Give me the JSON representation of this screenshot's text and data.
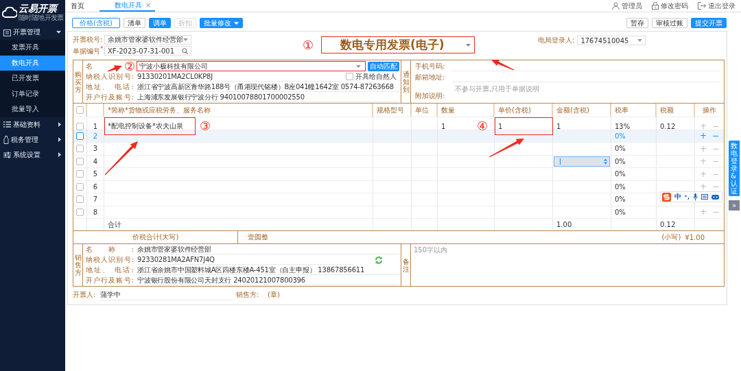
{
  "sidebar": {
    "logo_title": "云易开票",
    "logo_subtitle": "随时随地开发票",
    "groups": [
      {
        "label": "开票管理",
        "expanded": true,
        "items": [
          {
            "label": "发票开具",
            "selected": false
          },
          {
            "label": "数电开具",
            "selected": true
          },
          {
            "label": "已开发票",
            "selected": false
          },
          {
            "label": "订单记录",
            "selected": false
          },
          {
            "label": "批量导入",
            "selected": false
          }
        ]
      },
      {
        "label": "基础资料",
        "expanded": false
      },
      {
        "label": "税务管理",
        "expanded": false
      },
      {
        "label": "系统设置",
        "expanded": false
      }
    ]
  },
  "tabs": [
    {
      "label": "首页",
      "selected": false
    },
    {
      "label": "数电开具",
      "selected": true,
      "close": "×"
    }
  ],
  "user_menu": [
    {
      "label": "管理员"
    },
    {
      "label": "修改密码"
    },
    {
      "label": "退出登录"
    }
  ],
  "toolbar": {
    "left": [
      {
        "label": "价格(含税)",
        "kind": "outline"
      },
      {
        "label": "清单",
        "kind": "plain"
      },
      {
        "label": "调单",
        "kind": "primary"
      },
      {
        "label": "折扣",
        "kind": "disabled"
      },
      {
        "label": "批量修改",
        "kind": "dropdown"
      }
    ],
    "right": [
      {
        "label": "暂存",
        "kind": "plain"
      },
      {
        "label": "审核过账",
        "kind": "plain"
      },
      {
        "label": "提交开票",
        "kind": "primary"
      }
    ]
  },
  "header": {
    "tax_no_label": "开票税号:",
    "tax_no": "余姚市管家婆软件经营部",
    "doc_no_label": "单据编号$^{*}$:",
    "doc_no": "XF-2023-07-31-001",
    "invoice_type": "数电专用发票(电子)",
    "login_label": "电局登录人:",
    "login_user": "17674510045"
  },
  "buyer": {
    "title": "购买方",
    "name_label": "名",
    "name": "宁波小极科技有限公司",
    "match_button": "自动匹配",
    "tax_id_label": "纳税人识别号:",
    "tax_id": "91330201MA2CL0KP8J",
    "natural_person": {
      "label": "开具给自然人",
      "checked": false
    },
    "address_label": "地址、 电话:",
    "address": "浙江省宁波高新区青华路188号（甬港现代铭楼）B座041幢1642室 0574-87263668",
    "bank_label": "开户行及账号:",
    "bank": "上海浦东发展银行宁波分行 94010078801700002550"
  },
  "notify": {
    "title": "通知到",
    "phone_label": "手机号码:",
    "email_label": "邮箱地址:",
    "note_label": "附加说明:",
    "note_placeholder": "不参与开票,只用于单据说明"
  },
  "items": {
    "select_all_checked": false,
    "columns": [
      "*简称*货物或应税劳务、服务名称",
      "规格型号",
      "单位",
      "数量",
      "单价(含税)",
      "金额(含税)",
      "税率",
      "税额",
      "操作"
    ],
    "rows": [
      {
        "no": "1",
        "name": "*配电控制设备*农夫山泉",
        "quantity": "1",
        "price": "1",
        "amount": "1",
        "rate": "13%",
        "tax": "0.12",
        "checked": false,
        "highlighted": false,
        "editing": false,
        "actions": [
          "+",
          "−"
        ]
      },
      {
        "no": "2",
        "rate": "0%",
        "checked": false,
        "highlighted": true,
        "editing": false,
        "actions": [
          "+",
          "−"
        ]
      },
      {
        "no": "3",
        "rate": "0%",
        "checked": false,
        "highlighted": false,
        "editing": false,
        "actions": [
          "+",
          "−"
        ]
      },
      {
        "no": "4",
        "rate": "0%",
        "checked": false,
        "highlighted": false,
        "editing": true,
        "actions": [
          "+",
          "−"
        ]
      },
      {
        "no": "5",
        "rate": "0%",
        "checked": false,
        "highlighted": false,
        "editing": false,
        "actions": [
          "+",
          "−"
        ]
      },
      {
        "no": "6",
        "rate": "0%",
        "checked": false,
        "highlighted": false,
        "editing": false,
        "actions": [
          "+",
          "−"
        ]
      },
      {
        "no": "7",
        "rate": "0%",
        "checked": false,
        "highlighted": false,
        "editing": false
      },
      {
        "no": "8",
        "rate": "0%",
        "checked": false,
        "highlighted": false,
        "editing": false,
        "actions": [
          "+",
          "−"
        ]
      }
    ],
    "total_label": "合计",
    "total_amount": "1.00",
    "total_tax": "0.12"
  },
  "grand_total": {
    "label": "价税合计(大写)",
    "words": "壹圆整",
    "small_label": "(小写)",
    "small": "¥1.00"
  },
  "seller": {
    "title": "销售方",
    "name_label": "名称:",
    "name": "余姚市管家婆软件经营部",
    "tax_id_label": "纳税人识别号:",
    "tax_id": "92330281MA2AFN7J4Q",
    "address_label": "地址、 电话:",
    "address": "浙江省余姚市中国塑料城A区四楼东楼A-451室（自主申报） 13867856611",
    "bank_label": "开户行及账号:",
    "bank": "宁波银行股份有限公司天封支行 24020121007800396"
  },
  "remarks": {
    "title": "备注",
    "placeholder": "150字以内"
  },
  "footer": {
    "issuer_label": "开票人:",
    "issuer": "蒲学中",
    "seller_label": "销售方:",
    "seller_stamp": "(章)"
  },
  "side_tab": {
    "label": "数电登录&认证",
    "collapse": "»"
  },
  "ime": {
    "mode": "中"
  },
  "annotations": [
    {
      "number": "①"
    },
    {
      "number": "②"
    },
    {
      "number": "③"
    },
    {
      "number": "④"
    }
  ]
}
